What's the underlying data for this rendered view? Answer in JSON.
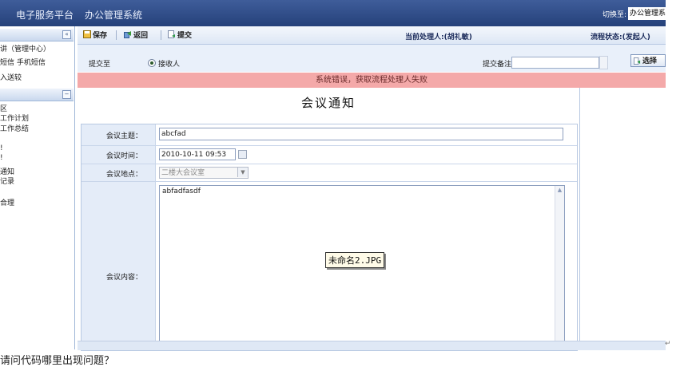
{
  "topbar": {
    "platform": "电子服务平台",
    "system": "办公管理系统",
    "switch_label": "切换至:",
    "switch_value": "办公管理系"
  },
  "left_panel": {
    "top_items": [
      "讲（管理中心）",
      "短信  手机短信",
      "入送较"
    ],
    "nav_items": [
      "区",
      "工作计划",
      "工作总结",
      "!",
      "!",
      "通知",
      "记录",
      "合理"
    ]
  },
  "toolbar": {
    "save": "保存",
    "back": "返回",
    "submit": "提交",
    "current_handler": "当前处理人:(胡礼敏)",
    "flow_status": "流程状态:(发起人)"
  },
  "submit_row": {
    "submit_to": "提交至",
    "radio_label": "接收人",
    "comment_label": "提交备注:",
    "select_button": "选择"
  },
  "error_message": "系统错误，获取流程处理人失败",
  "form": {
    "title": "会议通知",
    "fields": {
      "topic_label": "会议主题：",
      "topic_value": "abcfad",
      "time_label": "会议时间：",
      "time_value": "2010-10-11 09:53",
      "location_label": "会议地点：",
      "location_value": "二楼大会议室",
      "content_label": "会议内容：",
      "content_value": "abfadfasdf"
    }
  },
  "tooltip": "未命名2.JPG",
  "doc_text": "请问代码哪里出现问题？"
}
